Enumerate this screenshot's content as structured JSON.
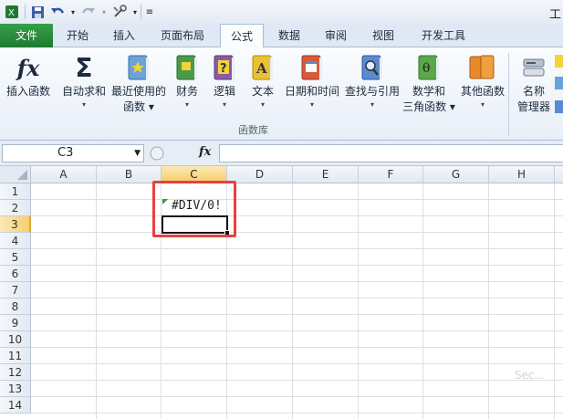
{
  "qat": {
    "title": "工"
  },
  "tabs": [
    "文件",
    "开始",
    "插入",
    "页面布局",
    "公式",
    "数据",
    "审阅",
    "视图",
    "开发工具"
  ],
  "ribbon": {
    "buttons": [
      {
        "line1": "插入函数",
        "line2": "",
        "icon": "fx-icon",
        "color": "#222"
      },
      {
        "line1": "自动求和",
        "line2": "▾",
        "icon": "sigma-icon",
        "color": "#222"
      },
      {
        "line1": "最近使用的",
        "line2": "函数 ▾",
        "icon": "star-book-icon",
        "color": "#6aa3d8"
      },
      {
        "line1": "财务",
        "line2": "▾",
        "icon": "finance-book-icon",
        "color": "#4a9a47"
      },
      {
        "line1": "逻辑",
        "line2": "▾",
        "icon": "logic-book-icon",
        "color": "#8a5aa8"
      },
      {
        "line1": "文本",
        "line2": "▾",
        "icon": "text-book-icon",
        "color": "#e8c232"
      },
      {
        "line1": "日期和时间",
        "line2": "▾",
        "icon": "datetime-book-icon",
        "color": "#d85a3a"
      },
      {
        "line1": "查找与引用",
        "line2": "▾",
        "icon": "lookup-book-icon",
        "color": "#5a8ad0"
      },
      {
        "line1": "数学和",
        "line2": "三角函数 ▾",
        "icon": "math-book-icon",
        "color": "#5aa84a"
      },
      {
        "line1": "其他函数",
        "line2": "▾",
        "icon": "more-book-icon",
        "color": "#e88a2a"
      },
      {
        "line1": "名称",
        "line2": "管理器",
        "icon": "name-manager-icon",
        "color": "#6a7a8a"
      }
    ],
    "group_label": "函数库"
  },
  "formula_bar": {
    "name_box": "C3",
    "fx": "fx",
    "value": ""
  },
  "grid": {
    "columns": [
      "A",
      "B",
      "C",
      "D",
      "E",
      "F",
      "G",
      "H"
    ],
    "rows": [
      "1",
      "2",
      "3",
      "4",
      "5",
      "6",
      "7",
      "8",
      "9",
      "10",
      "11",
      "12",
      "13",
      "14"
    ],
    "selected_column": "C",
    "selected_row": "3",
    "cell_c2": "#DIV/0!"
  },
  "watermark": "Sec..."
}
